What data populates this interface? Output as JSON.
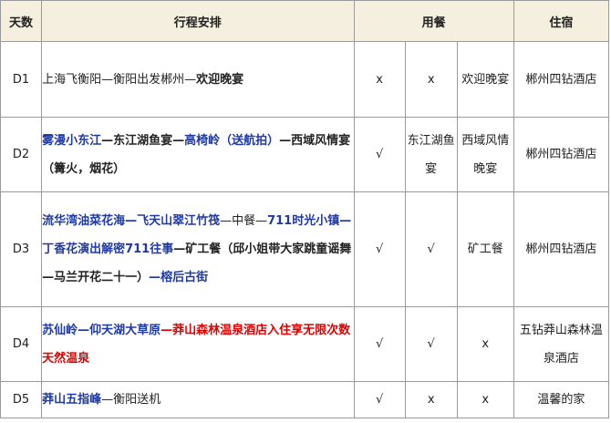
{
  "headers": {
    "day": "天数",
    "plan": "行程安排",
    "meals": "用餐",
    "stay": "住宿"
  },
  "rows": [
    {
      "day": "D1",
      "plan": [
        {
          "text": "上海飞衡阳—衡阳出发郴州—",
          "style": "dark"
        },
        {
          "text": "欢迎晚宴",
          "style": "darkb"
        }
      ],
      "meals": [
        "x",
        "x",
        "欢迎晚宴"
      ],
      "stay": "郴州四钻酒店"
    },
    {
      "day": "D2",
      "plan": [
        {
          "text": "雾漫小东江",
          "style": "blue"
        },
        {
          "text": "—东江湖鱼宴—",
          "style": "darkb"
        },
        {
          "text": "高椅岭（送航拍）",
          "style": "blue"
        },
        {
          "text": "—西域风情宴（篝火，烟花）",
          "style": "darkb"
        }
      ],
      "meals": [
        "√",
        "东江湖鱼宴",
        "西域风情晚宴"
      ],
      "stay": "郴州四钻酒店"
    },
    {
      "day": "D3",
      "plan": [
        {
          "text": "流华湾油菜花海—飞天山翠江竹筏",
          "style": "blue"
        },
        {
          "text": "—中餐—",
          "style": "dark"
        },
        {
          "text": "711时光小镇—丁香花演出解密711往事",
          "style": "blue"
        },
        {
          "text": "—矿工餐（邱小姐带大家跳童谣舞—马兰开花二十一）",
          "style": "darkb"
        },
        {
          "text": "—榕后古街",
          "style": "blue"
        }
      ],
      "meals": [
        "√",
        "√",
        "矿工餐"
      ],
      "stay": "郴州四钻酒店"
    },
    {
      "day": "D4",
      "plan": [
        {
          "text": "苏仙岭—仰天湖大草原",
          "style": "blue"
        },
        {
          "text": "—莽山森林温泉酒店入住享无限次数天然温泉",
          "style": "red"
        }
      ],
      "meals": [
        "√",
        "√",
        "x"
      ],
      "stay": "五钻莽山森林温泉酒店"
    },
    {
      "day": "D5",
      "plan": [
        {
          "text": "莽山五指峰",
          "style": "blue"
        },
        {
          "text": "—衡阳送机",
          "style": "dark"
        }
      ],
      "meals": [
        "√",
        "x",
        "x"
      ],
      "stay": "温馨的家"
    }
  ]
}
